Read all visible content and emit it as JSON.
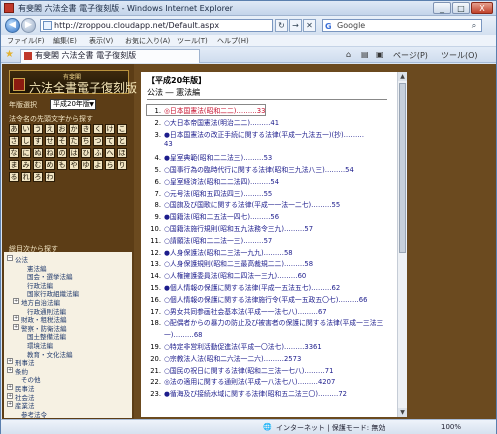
{
  "window": {
    "title": "有斐閣 六法全書 電子復刻版 - Windows Internet Explorer",
    "min": "_",
    "max": "□",
    "close": "X"
  },
  "address": {
    "url": "http://zroppou.cloudapp.net/Default.aspx",
    "refresh": "↻",
    "stop": "✕",
    "go": "→"
  },
  "search": {
    "engine": "G",
    "text": "Google",
    "button": "⌕"
  },
  "menu": [
    "ファイル(F)",
    "編集(E)",
    "表示(V)",
    "お気に入り(A)",
    "ツール(T)",
    "ヘルプ(H)"
  ],
  "tab": {
    "label": "有斐閣 六法全書 電子復刻版"
  },
  "commands": [
    "⌂",
    "▤",
    "▣",
    "ページ(P)",
    "ツール(O)"
  ],
  "sidebar": {
    "logo_small": "有斐閣",
    "logo_main": "六法全書電子復刻版",
    "year_label": "年版選択",
    "year_value": "平成20年版",
    "search_label": "法令名の先頭文字から探す",
    "kana": [
      "あ",
      "い",
      "う",
      "え",
      "お",
      "か",
      "き",
      "く",
      "け",
      "こ",
      "さ",
      "し",
      "す",
      "せ",
      "そ",
      "た",
      "ち",
      "つ",
      "て",
      "と",
      "な",
      "に",
      "ぬ",
      "ね",
      "の",
      "は",
      "ひ",
      "ふ",
      "へ",
      "ほ",
      "ま",
      "み",
      "む",
      "め",
      "も",
      "や",
      "ゆ",
      "よ",
      "ら",
      "り",
      "る",
      "れ",
      "ろ",
      "わ"
    ],
    "toc_label": "総目次から探す",
    "tree": [
      {
        "label": "公法",
        "level": 0,
        "exp": "−"
      },
      {
        "label": "憲法編",
        "level": 2
      },
      {
        "label": "国会・選挙法編",
        "level": 2
      },
      {
        "label": "行政法編",
        "level": 2
      },
      {
        "label": "国家行政組織法編",
        "level": 2
      },
      {
        "label": "地方自治法編",
        "level": 1,
        "exp": "+"
      },
      {
        "label": "行政通則法編",
        "level": 2
      },
      {
        "label": "財政・租税法編",
        "level": 1,
        "exp": "+"
      },
      {
        "label": "警察・防衛法編",
        "level": 1,
        "exp": "+"
      },
      {
        "label": "国土整備法編",
        "level": 2
      },
      {
        "label": "環境法編",
        "level": 2
      },
      {
        "label": "教育・文化法編",
        "level": 2
      },
      {
        "label": "刑事法",
        "level": 0,
        "exp": "+"
      },
      {
        "label": "条約",
        "level": 0,
        "exp": "+"
      },
      {
        "label": "その他",
        "level": 1
      },
      {
        "label": "民事法",
        "level": 0,
        "exp": "+"
      },
      {
        "label": "社会法",
        "level": 0,
        "exp": "+"
      },
      {
        "label": "産業法",
        "level": 0,
        "exp": "+"
      },
      {
        "label": "参考法令",
        "level": 1
      }
    ]
  },
  "main": {
    "edition": "【平成20年版】",
    "category": "公法 ― 憲法編",
    "laws": [
      {
        "n": "1.",
        "t": "◎日本国憲法(昭和二二)………33",
        "hl": true,
        "sel": true
      },
      {
        "n": "2.",
        "t": "○大日本帝国憲法(明治二二)………41"
      },
      {
        "n": "3.",
        "t": "●日本国憲法の改正手続に関する法律(平成一九法五一)(抄)………",
        "cont": "43"
      },
      {
        "n": "4.",
        "t": "●皇室典範(昭和二二法三)………53"
      },
      {
        "n": "5.",
        "t": "○国事行為の臨時代行に関する法律(昭和三九法八三)………54"
      },
      {
        "n": "6.",
        "t": "○皇室経済法(昭和二二法四)………54"
      },
      {
        "n": "7.",
        "t": "○元号法(昭和五四法四三)………55"
      },
      {
        "n": "8.",
        "t": "○国旗及び国歌に関する法律(平成一一法一二七)………55"
      },
      {
        "n": "9.",
        "t": "●国籍法(昭和二五法一四七)………56"
      },
      {
        "n": "10.",
        "t": "○国籍法施行規則(昭和五九法務令三九)………57"
      },
      {
        "n": "11.",
        "t": "○請願法(昭和二二法一三)………57"
      },
      {
        "n": "12.",
        "t": "●人身保護法(昭和二三法一九九)………58"
      },
      {
        "n": "13.",
        "t": "○人身保護規則(昭和二三最高裁規二二)………58"
      },
      {
        "n": "14.",
        "t": "○人権擁護委員法(昭和二四法一三九)………60"
      },
      {
        "n": "15.",
        "t": "●個人情報の保護に関する法律(平成一五法五七)………62"
      },
      {
        "n": "16.",
        "t": "○個人情報の保護に関する法律施行令(平成一五政五〇七)………66"
      },
      {
        "n": "17.",
        "t": "○男女共同参画社会基本法(平成一一法七八)………67"
      },
      {
        "n": "18.",
        "t": "○配偶者からの暴力の防止及び被害者の保護に関する法律(平成一三法三",
        "cont": "一)………68"
      },
      {
        "n": "19.",
        "t": "○特定非営利活動促進法(平成一〇法七)………3361"
      },
      {
        "n": "20.",
        "t": "○宗教法人法(昭和二六法一二六)………2573"
      },
      {
        "n": "21.",
        "t": "○国民の祝日に関する法律(昭和二三法一七八)………71"
      },
      {
        "n": "22.",
        "t": "◎法の適用に関する通則法(平成一八法七八)………4207"
      },
      {
        "n": "23.",
        "t": "●循海及び接続水域に関する法律(昭和五二法三〇)………72"
      }
    ]
  },
  "status": {
    "zone": "インターネット | 保護モード: 無効",
    "zoom": "100%"
  }
}
